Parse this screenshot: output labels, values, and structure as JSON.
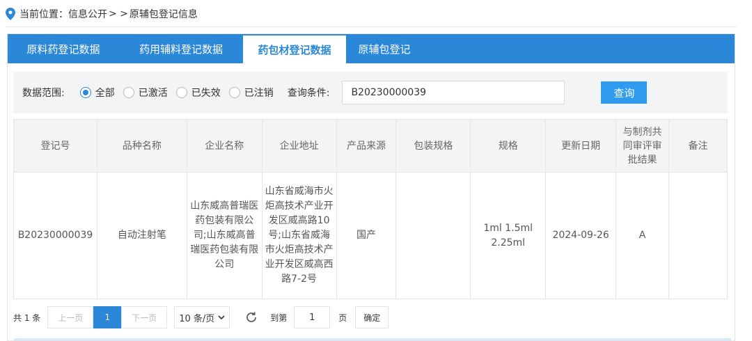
{
  "breadcrumb": {
    "prefix": "当前位置：",
    "section": "信息公开",
    "separator": "> >",
    "current": "原辅包登记信息"
  },
  "tabs": [
    {
      "label": "原料药登记数据",
      "active": false
    },
    {
      "label": "药用辅料登记数据",
      "active": false
    },
    {
      "label": "药包材登记数据",
      "active": true
    },
    {
      "label": "原辅包登记",
      "active": false
    }
  ],
  "filter": {
    "range_label": "数据范围:",
    "options": [
      "全部",
      "已激活",
      "已失效",
      "已注销"
    ],
    "selected": "全部",
    "query_label": "查询条件:",
    "query_value": "B20230000039",
    "search_button": "查询"
  },
  "table": {
    "headers": [
      "登记号",
      "品种名称",
      "企业名称",
      "企业地址",
      "产品来源",
      "包装规格",
      "规格",
      "更新日期",
      "与制剂共同审评审批结果",
      "备注"
    ],
    "rows": [
      [
        "B20230000039",
        "自动注射笔",
        "山东威高普瑞医药包装有限公司;山东威高普瑞医药包装有限公司",
        "山东省威海市火炬高技术产业开发区威高路10号;山东省威海市火炬高技术产业开发区威高西路7-2号",
        "国产",
        "",
        "1ml 1.5ml 2.25ml",
        "2024-09-26",
        "A",
        ""
      ]
    ]
  },
  "pagination": {
    "total": "共 1 条",
    "prev": "上一页",
    "current_page": "1",
    "next": "下一页",
    "page_size": "10 条/页",
    "goto_label": "到第",
    "goto_value": "1",
    "page_unit": "页",
    "confirm": "确定"
  },
  "colors": {
    "primary": "#2b88d8",
    "button": "#2e9bf0",
    "header_bg": "#f2f4f6"
  }
}
